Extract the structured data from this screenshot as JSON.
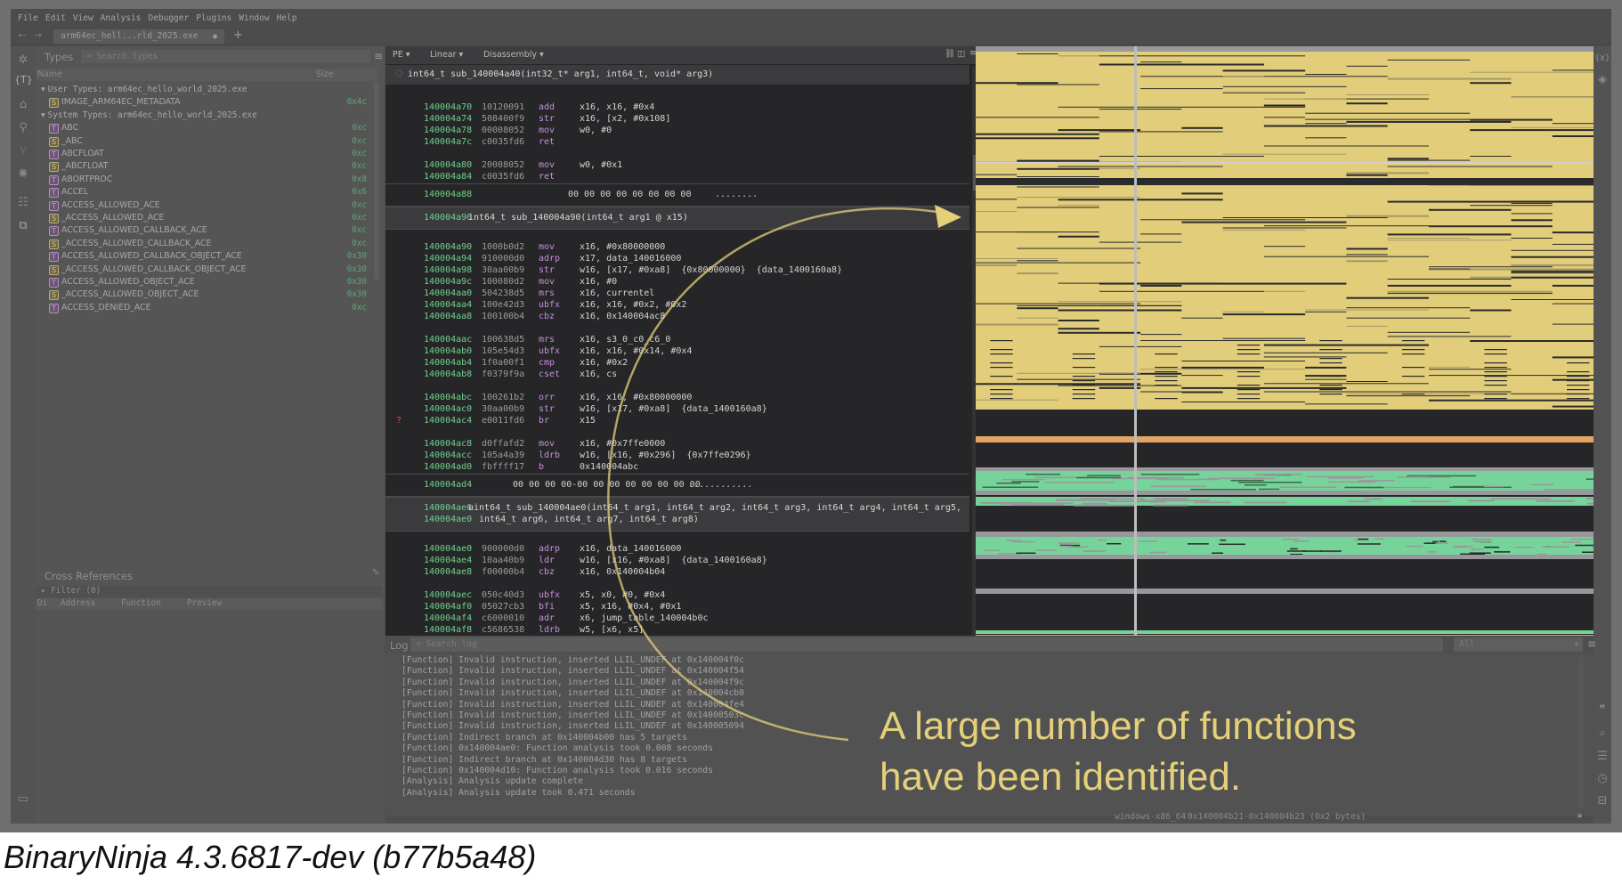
{
  "menu": [
    "File",
    "Edit",
    "View",
    "Analysis",
    "Debugger",
    "Plugins",
    "Window",
    "Help"
  ],
  "tab": {
    "title": "arm64ec_hell...rld_2025.exe",
    "modified_dot": "●",
    "add": "+"
  },
  "nav": {
    "back": "←",
    "forward": "→"
  },
  "types_panel": {
    "title": "Types",
    "search_placeholder": "Search types",
    "col_name": "Name",
    "col_size": "Size",
    "rows": [
      {
        "kind": "group",
        "label": "User Types: arm64ec_hello_world_2025.exe"
      },
      {
        "kind": "item",
        "badge": "S",
        "name": "IMAGE_ARM64EC_METADATA",
        "size": "0x4c"
      },
      {
        "kind": "group",
        "label": "System Types: arm64ec_hello_world_2025.exe"
      },
      {
        "kind": "item",
        "badge": "T",
        "name": "ABC",
        "size": "0xc"
      },
      {
        "kind": "item",
        "badge": "S",
        "name": "_ABC",
        "size": "0xc"
      },
      {
        "kind": "item",
        "badge": "T",
        "name": "ABCFLOAT",
        "size": "0xc"
      },
      {
        "kind": "item",
        "badge": "S",
        "name": "_ABCFLOAT",
        "size": "0xc"
      },
      {
        "kind": "item",
        "badge": "T",
        "name": "ABORTPROC",
        "size": "0x8"
      },
      {
        "kind": "item",
        "badge": "T",
        "name": "ACCEL",
        "size": "0x6"
      },
      {
        "kind": "item",
        "badge": "T",
        "name": "ACCESS_ALLOWED_ACE",
        "size": "0xc"
      },
      {
        "kind": "item",
        "badge": "S",
        "name": "_ACCESS_ALLOWED_ACE",
        "size": "0xc"
      },
      {
        "kind": "item",
        "badge": "T",
        "name": "ACCESS_ALLOWED_CALLBACK_ACE",
        "size": "0xc"
      },
      {
        "kind": "item",
        "badge": "S",
        "name": "_ACCESS_ALLOWED_CALLBACK_ACE",
        "size": "0xc"
      },
      {
        "kind": "item",
        "badge": "T",
        "name": "ACCESS_ALLOWED_CALLBACK_OBJECT_ACE",
        "size": "0x30"
      },
      {
        "kind": "item",
        "badge": "S",
        "name": "_ACCESS_ALLOWED_CALLBACK_OBJECT_ACE",
        "size": "0x30"
      },
      {
        "kind": "item",
        "badge": "T",
        "name": "ACCESS_ALLOWED_OBJECT_ACE",
        "size": "0x30"
      },
      {
        "kind": "item",
        "badge": "S",
        "name": "_ACCESS_ALLOWED_OBJECT_ACE",
        "size": "0x30"
      },
      {
        "kind": "item",
        "badge": "T",
        "name": "ACCESS_DENIED_ACE",
        "size": "0xc"
      }
    ]
  },
  "xref_panel": {
    "title": "Cross References",
    "filter": "Filter (0)",
    "cols": [
      "Di",
      "Address",
      "Function",
      "Preview"
    ]
  },
  "disasm": {
    "view_selectors": [
      "PE ▾",
      "Linear ▾",
      "Disassembly ▾"
    ],
    "sticky_header": "int64_t sub_140004a40(int32_t* arg1, int64_t, void* arg3)",
    "lines": [
      {
        "k": "ins",
        "a": "140004a70",
        "b": "10120091",
        "m": "add",
        "o": "x16, x16, #0x4"
      },
      {
        "k": "ins",
        "a": "140004a74",
        "b": "508400f9",
        "m": "str",
        "o": "x16, [x2, #0x108]"
      },
      {
        "k": "ins",
        "a": "140004a78",
        "b": "00008052",
        "m": "mov",
        "o": "w0, #0"
      },
      {
        "k": "ins",
        "a": "140004a7c",
        "b": "c0035fd6",
        "m": "ret",
        "o": ""
      },
      {
        "k": "blank"
      },
      {
        "k": "ins",
        "a": "140004a80",
        "b": "20008052",
        "m": "mov",
        "o": "w0, #0x1"
      },
      {
        "k": "ins",
        "a": "140004a84",
        "b": "c0035fd6",
        "m": "ret",
        "o": ""
      },
      {
        "k": "data",
        "a": "140004a88",
        "hex": "00 00 00 00 00 00 00 00",
        "ascii": "........"
      },
      {
        "k": "func",
        "a": "140004a90",
        "sig": [
          "int64_t sub_140004a90(int64_t arg1 @ x15)"
        ]
      },
      {
        "k": "ins",
        "a": "140004a90",
        "b": "1000b0d2",
        "m": "mov",
        "o": "x16, #0x80000000"
      },
      {
        "k": "ins",
        "a": "140004a94",
        "b": "910000d0",
        "m": "adrp",
        "o": "x17, data_140016000"
      },
      {
        "k": "ins",
        "a": "140004a98",
        "b": "30aa00b9",
        "m": "str",
        "o": "w16, [x17, #0xa8]  {0x80000000}  {data_1400160a8}"
      },
      {
        "k": "ins",
        "a": "140004a9c",
        "b": "100080d2",
        "m": "mov",
        "o": "x16, #0"
      },
      {
        "k": "ins",
        "a": "140004aa0",
        "b": "504238d5",
        "m": "mrs",
        "o": "x16, currentel"
      },
      {
        "k": "ins",
        "a": "140004aa4",
        "b": "100e42d3",
        "m": "ubfx",
        "o": "x16, x16, #0x2, #0x2"
      },
      {
        "k": "ins",
        "a": "140004aa8",
        "b": "100100b4",
        "m": "cbz",
        "o": "x16, 0x140004ac8"
      },
      {
        "k": "blank"
      },
      {
        "k": "ins",
        "a": "140004aac",
        "b": "100638d5",
        "m": "mrs",
        "o": "x16, s3_0_c0_c6_0"
      },
      {
        "k": "ins",
        "a": "140004ab0",
        "b": "105e54d3",
        "m": "ubfx",
        "o": "x16, x16, #0x14, #0x4"
      },
      {
        "k": "ins",
        "a": "140004ab4",
        "b": "1f0a00f1",
        "m": "cmp",
        "o": "x16, #0x2"
      },
      {
        "k": "ins",
        "a": "140004ab8",
        "b": "f0379f9a",
        "m": "cset",
        "o": "x16, cs"
      },
      {
        "k": "blank"
      },
      {
        "k": "ins",
        "a": "140004abc",
        "b": "100261b2",
        "m": "orr",
        "o": "x16, x16, #0x80000000"
      },
      {
        "k": "ins",
        "a": "140004ac0",
        "b": "30aa00b9",
        "m": "str",
        "o": "w16, [x17, #0xa8]  {data_1400160a8}"
      },
      {
        "k": "ins",
        "a": "140004ac4",
        "b": "e0011fd6",
        "m": "br",
        "o": "x15",
        "mark": "?"
      },
      {
        "k": "blank"
      },
      {
        "k": "ins",
        "a": "140004ac8",
        "b": "d0ffafd2",
        "m": "mov",
        "o": "x16, #0x7ffe0000"
      },
      {
        "k": "ins",
        "a": "140004acc",
        "b": "105a4a39",
        "m": "ldrb",
        "o": "w16, [x16, #0x296]  {0x7ffe0296}"
      },
      {
        "k": "ins",
        "a": "140004ad0",
        "b": "fbffff17",
        "m": "b",
        "o": "0x140004abc"
      },
      {
        "k": "data",
        "a": "140004ad4",
        "hex": "00 00 00 00-00 00 00 00 00 00 00 00",
        "ascii": "............"
      },
      {
        "k": "func",
        "a": "140004ae0",
        "sig": [
          "uint64_t sub_140004ae0(int64_t arg1, int64_t arg2, int64_t arg3, int64_t arg4, int64_t arg5,",
          "  int64_t arg6, int64_t arg7, int64_t arg8)"
        ]
      },
      {
        "k": "ins",
        "a": "140004ae0",
        "b": "900000d0",
        "m": "adrp",
        "o": "x16, data_140016000"
      },
      {
        "k": "ins",
        "a": "140004ae4",
        "b": "10aa40b9",
        "m": "ldr",
        "o": "w16, [x16, #0xa8]  {data_1400160a8}"
      },
      {
        "k": "ins",
        "a": "140004ae8",
        "b": "f00000b4",
        "m": "cbz",
        "o": "x16, 0x140004b04"
      },
      {
        "k": "blank"
      },
      {
        "k": "ins",
        "a": "140004aec",
        "b": "050c40d3",
        "m": "ubfx",
        "o": "x5, x0, #0, #0x4"
      },
      {
        "k": "ins",
        "a": "140004af0",
        "b": "05027cb3",
        "m": "bfi",
        "o": "x5, x16, #0x4, #0x1"
      },
      {
        "k": "ins",
        "a": "140004af4",
        "b": "c6000010",
        "m": "adr",
        "o": "x6, jump_table_140004b0c"
      },
      {
        "k": "ins",
        "a": "140004af8",
        "b": "c5686538",
        "m": "ldrb",
        "o": "w5, [x6, x5]"
      }
    ]
  },
  "log": {
    "title": "Log",
    "search_placeholder": "Search log",
    "level": "All",
    "lines": [
      "[Function] Invalid instruction, inserted LLIL_UNDEF at 0x140004f0c",
      "[Function] Invalid instruction, inserted LLIL_UNDEF at 0x140004f54",
      "[Function] Invalid instruction, inserted LLIL_UNDEF at 0x140004f9c",
      "[Function] Invalid instruction, inserted LLIL_UNDEF at 0x140004cb0",
      "[Function] Invalid instruction, inserted LLIL_UNDEF at 0x140004fe4",
      "[Function] Invalid instruction, inserted LLIL_UNDEF at 0x14000503c",
      "[Function] Invalid instruction, inserted LLIL_UNDEF at 0x140005094",
      "[Function] Indirect branch at 0x140004b00 has 5 targets",
      "[Function] 0x140004ae0: Function analysis took 0.008 seconds",
      "[Function] Indirect branch at 0x140004d30 has 8 targets",
      "[Function] 0x140004d10: Function analysis took 0.016 seconds",
      "[Analysis] Analysis update complete",
      "[Analysis] Analysis update took 0.471 seconds"
    ]
  },
  "status": {
    "platform": "windows-x86_64",
    "selection": "0x140004b21-0x140004b23 (0x2 bytes)"
  },
  "annotation": {
    "line1": "A large number of functions",
    "line2": "have been identified."
  },
  "caption": "BinaryNinja 4.3.6817-dev (b77b5a48)",
  "feature_map_colors": {
    "code": "#e2cd7b",
    "data": "#76d49b",
    "string": "#e3a464",
    "other": "#98989c",
    "empty": "#262628"
  },
  "colors": {
    "annotation": "#e4cf7a",
    "address": "#6fd08c",
    "mnemonic": "#c58fdc",
    "function_name": "#e5c85c",
    "data_ref": "#e47b6d"
  }
}
